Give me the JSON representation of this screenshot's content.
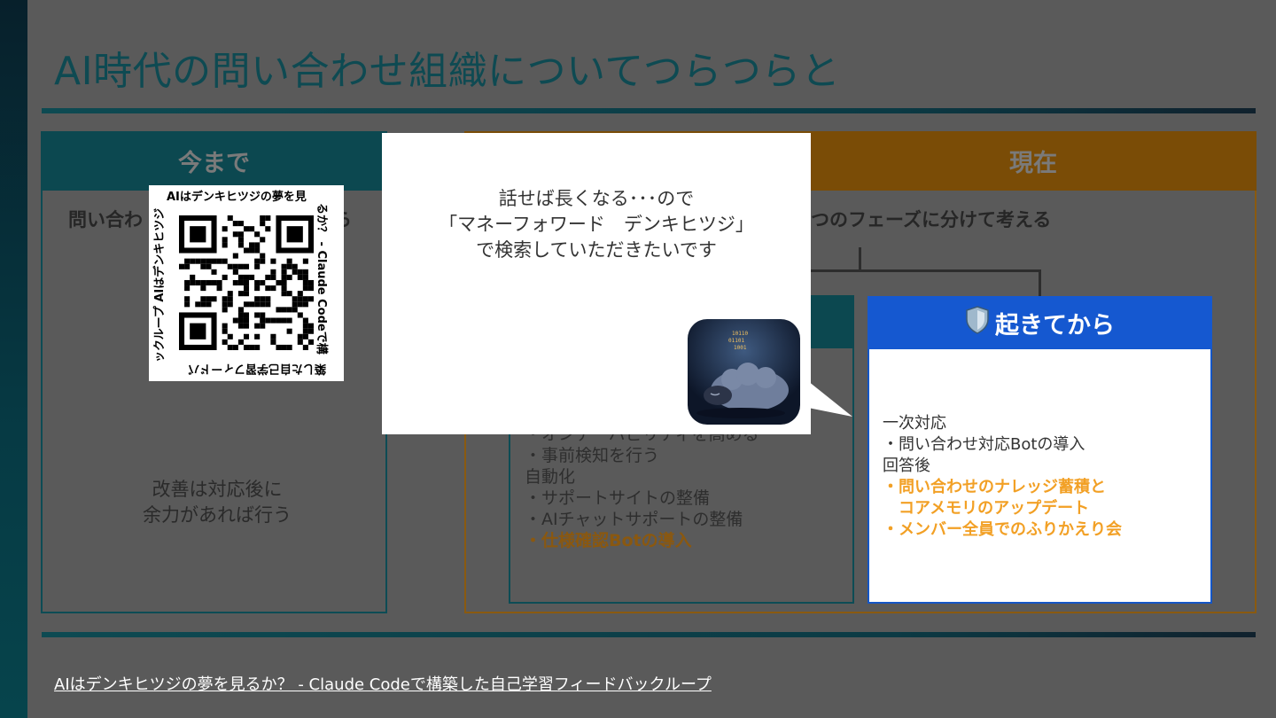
{
  "slide": {
    "title": "AI時代の問い合わせ組織についてつらつらと",
    "footer_link": "AIはデンキヒツジの夢を見るか？ - Claude Codeで構築した自己学習フィードバックループ"
  },
  "left_panel": {
    "header": "今まで",
    "line_start": "問い合わ",
    "line_end": "ら",
    "note": [
      "改善は対応後に",
      "余力があれば行う"
    ]
  },
  "right_panel": {
    "header": "現在",
    "line": "つのフェーズに分けて考える"
  },
  "mid_box": {
    "items": [
      "・オンデーバビリティを高める",
      "・事前検知を行う",
      "自動化",
      "・サポートサイトの整備",
      "・AIチャットサポートの整備"
    ],
    "highlight": "・仕様確認Botの導入"
  },
  "after_box": {
    "icon": "shield-icon",
    "header": "起きてから",
    "items": [
      "一次対応",
      "・問い合わせ対応Botの導入",
      "回答後"
    ],
    "highlights": [
      "・問い合わせのナレッジ蓄積と",
      "　コアメモリのアップデート",
      "・メンバー全員でのふりかえり会"
    ]
  },
  "bubble": {
    "lines": [
      "話せば長くなる･･･ので",
      "「マネーフォワード　デンキヒツジ」",
      "で検索していただきたいです"
    ]
  },
  "qr": {
    "top": "AIはデンキヒツジの夢を見",
    "right": "るか？ - Claude Codeで構",
    "bottom": "築した自己学習フィードバ",
    "left": "ックループ AIはデンキヒツジ"
  },
  "colors": {
    "teal": "#0c4850",
    "brown": "#7a4c06",
    "blue": "#1558d0",
    "orange": "#f2a025",
    "dim_bg": "#5a5a5a"
  }
}
